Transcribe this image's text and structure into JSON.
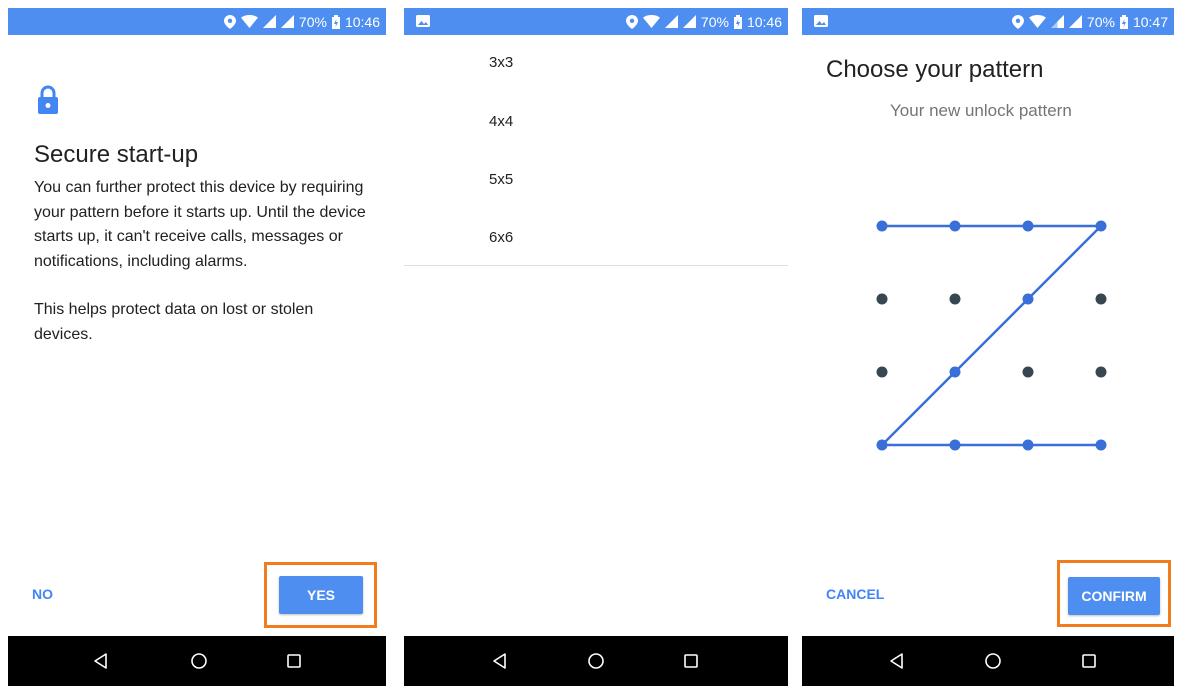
{
  "status_bar": {
    "battery": [
      "70%",
      "70%",
      "70%"
    ],
    "time": [
      "10:46",
      "10:46",
      "10:47"
    ]
  },
  "screen1": {
    "title": "Secure start-up",
    "paragraph1": "You can further protect this device by requiring your pattern before it starts up. Until the device starts up, it can't receive calls, messages or notifications, including alarms.",
    "paragraph2": "This helps protect data on lost or stolen devices.",
    "no_label": "NO",
    "yes_label": "YES"
  },
  "screen2": {
    "grid_sizes": [
      "3x3",
      "4x4",
      "5x5",
      "6x6"
    ]
  },
  "screen3": {
    "title": "Choose your pattern",
    "subtitle": "Your new unlock pattern",
    "cancel_label": "CANCEL",
    "confirm_label": "CONFIRM",
    "pattern_grid": "4x4",
    "pattern_sequence": [
      [
        0,
        0
      ],
      [
        0,
        1
      ],
      [
        0,
        2
      ],
      [
        0,
        3
      ],
      [
        1,
        2
      ],
      [
        2,
        1
      ],
      [
        3,
        0
      ],
      [
        3,
        1
      ],
      [
        3,
        2
      ],
      [
        3,
        3
      ]
    ]
  },
  "colors": {
    "accent": "#4285f4",
    "status_bar": "#4d8ef0",
    "highlight": "#f07c1d",
    "pattern_line": "#3b6fd8",
    "inactive_dot": "#37474f"
  },
  "icons": {
    "status": [
      "location-icon",
      "wifi-icon",
      "signal-icon",
      "signal-icon",
      "battery-icon"
    ],
    "nav": [
      "back-icon",
      "home-icon",
      "recents-icon"
    ],
    "screen1": "lock-icon",
    "notification": "image-notification-icon"
  }
}
